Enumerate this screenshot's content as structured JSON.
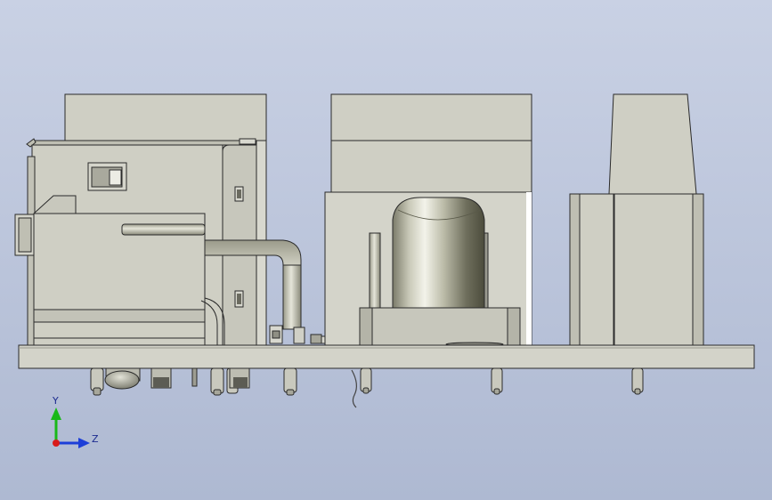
{
  "viewport": {
    "background_top": "#c9d1e4",
    "background_bottom": "#aeb9d2",
    "model_fill": "#cfcfc4",
    "model_fill_dark": "#b9b9ad",
    "model_edge": "#2a2a2a"
  },
  "triad": {
    "y_label": "Y",
    "z_label": "Z",
    "y_color": "#19b819",
    "z_color": "#1d3fd8",
    "origin_color": "#d81a1a"
  }
}
